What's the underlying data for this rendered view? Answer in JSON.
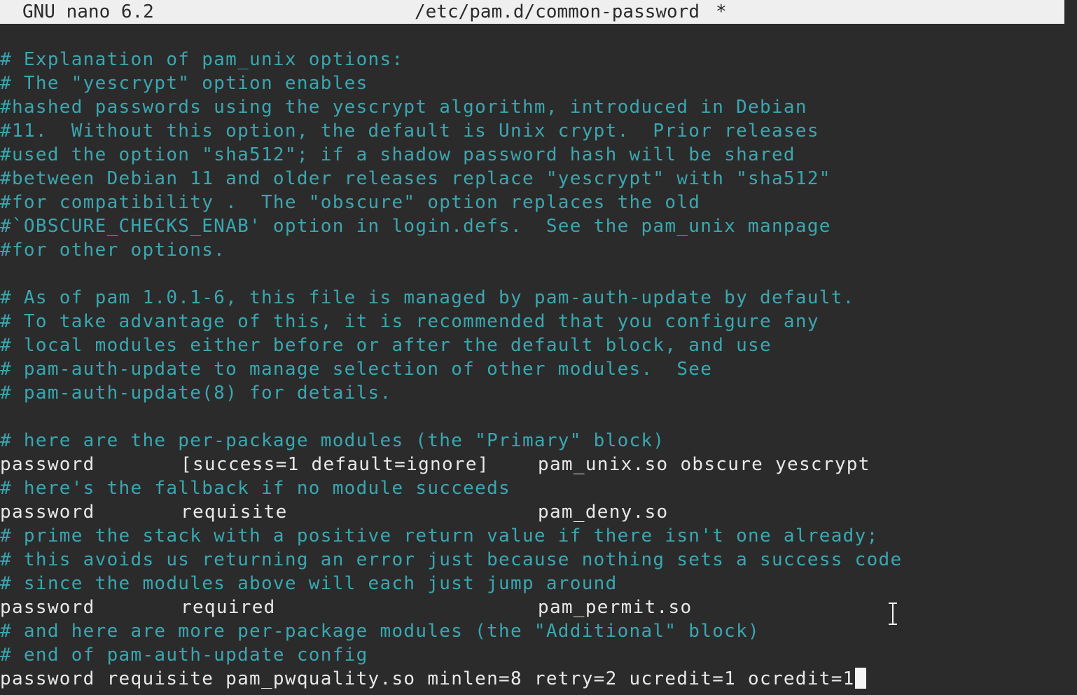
{
  "titlebar": {
    "app": "GNU nano 6.2",
    "filename": "/etc/pam.d/common-password",
    "modified_marker": "*"
  },
  "lines": [
    "# Explanation of pam_unix options:",
    "# The \"yescrypt\" option enables",
    "#hashed passwords using the yescrypt algorithm, introduced in Debian",
    "#11.  Without this option, the default is Unix crypt.  Prior releases",
    "#used the option \"sha512\"; if a shadow password hash will be shared",
    "#between Debian 11 and older releases replace \"yescrypt\" with \"sha512\"",
    "#for compatibility .  The \"obscure\" option replaces the old",
    "#`OBSCURE_CHECKS_ENAB' option in login.defs.  See the pam_unix manpage",
    "#for other options.",
    "",
    "# As of pam 1.0.1-6, this file is managed by pam-auth-update by default.",
    "# To take advantage of this, it is recommended that you configure any",
    "# local modules either before or after the default block, and use",
    "# pam-auth-update to manage selection of other modules.  See",
    "# pam-auth-update(8) for details.",
    "",
    "# here are the per-package modules (the \"Primary\" block)",
    "# here's the fallback if no module succeeds",
    "# prime the stack with a positive return value if there isn't one already;",
    "# this avoids us returning an error just because nothing sets a success code",
    "# since the modules above will each just jump around",
    "# and here are more per-package modules (the \"Additional\" block)",
    "# end of pam-auth-update config",
    "password requisite pam_pwquality.so minlen=8 retry=2 ucredit=1 ocredit=1"
  ],
  "rules": [
    {
      "type": "password",
      "control": "[success=1 default=ignore]",
      "module": "pam_unix.so obscure yescrypt"
    },
    {
      "type": "password",
      "control": "requisite",
      "module": "pam_deny.so"
    },
    {
      "type": "password",
      "control": "required",
      "module": "pam_permit.so"
    }
  ],
  "colors": {
    "background": "#2b2b2b",
    "comment": "#3aa7b1",
    "code": "#e8e8e8",
    "titlebar_bg": "#efefef"
  },
  "icons": {
    "cursor": "block-cursor",
    "mouse": "ibeam-pointer-icon"
  }
}
